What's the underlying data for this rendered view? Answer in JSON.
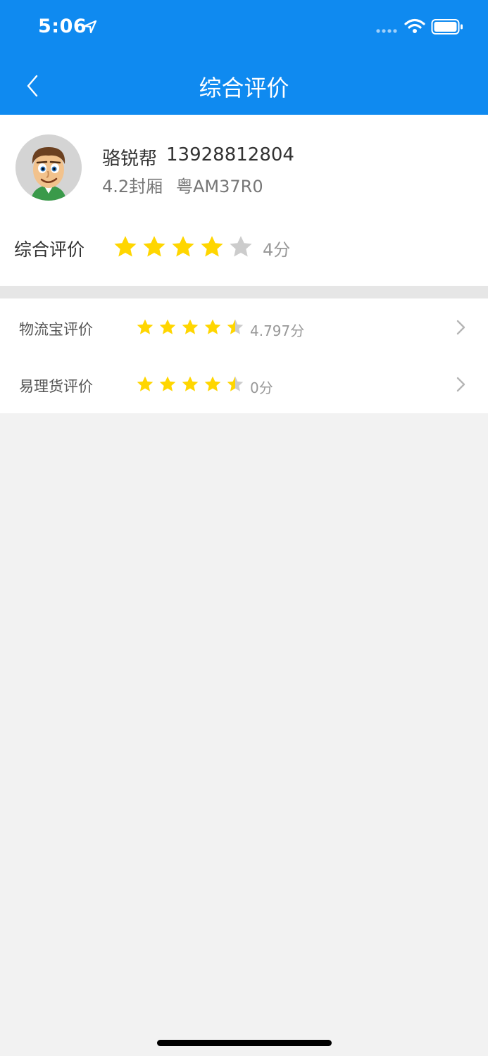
{
  "status_bar": {
    "time": "5:06"
  },
  "nav": {
    "title": "综合评价"
  },
  "driver": {
    "name": "骆锐帮",
    "phone": "13928812804",
    "vehicle_type": "4.2封厢",
    "plate": "粤AM37R0"
  },
  "overall": {
    "label": "综合评价",
    "rating": 4,
    "max": 5,
    "score_text": "4分"
  },
  "ratings": [
    {
      "label": "物流宝评价",
      "rating": 4.5,
      "max": 5,
      "score_text": "4.797分"
    },
    {
      "label": "易理货评价",
      "rating": 4.5,
      "max": 5,
      "score_text": "0分"
    }
  ],
  "colors": {
    "primary": "#0f8af0",
    "star_filled": "#ffd600",
    "star_empty": "#cccccc"
  }
}
